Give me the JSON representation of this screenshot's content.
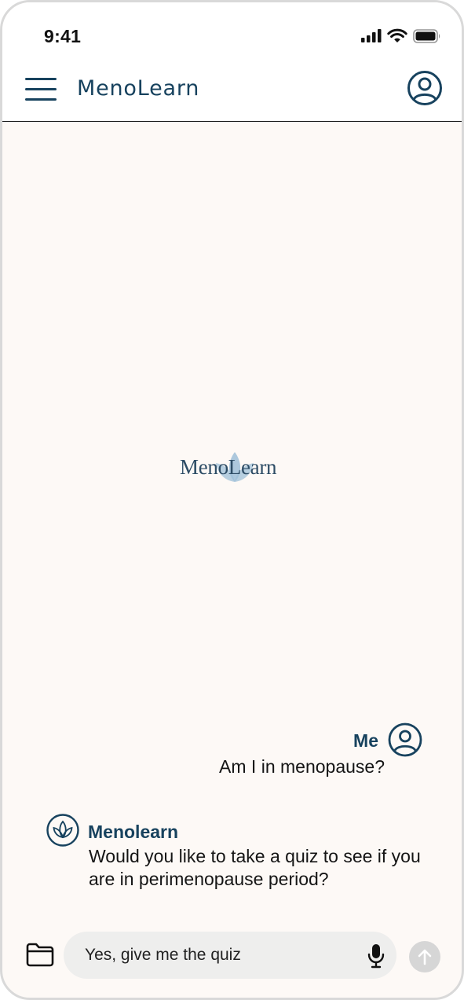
{
  "status_bar": {
    "time": "9:41",
    "icons": [
      "signal-icon",
      "wifi-icon",
      "battery-icon"
    ]
  },
  "header": {
    "menu_icon": "hamburger-menu-icon",
    "title": "MenoLearn",
    "profile_icon": "user-profile-icon"
  },
  "center_logo": {
    "text": "MenoLearn",
    "icon": "lotus-icon"
  },
  "messages": [
    {
      "sender": "Me",
      "text": "Am I in menopause?",
      "avatar_icon": "user-profile-icon"
    },
    {
      "sender": "Menolearn",
      "text": "Would you like to take a quiz to see if you are in perimenopause period?",
      "avatar_icon": "lotus-icon"
    }
  ],
  "composer": {
    "folder_icon": "folder-icon",
    "value": "Yes, give me the quiz",
    "mic_icon": "microphone-icon",
    "send_icon": "arrow-up-icon"
  },
  "colors": {
    "brand": "#17425e",
    "background": "#fdf9f6",
    "input_background": "#eeeeed",
    "send_button_disabled": "#d6d6d6",
    "lotus": "#9fc0d8"
  }
}
